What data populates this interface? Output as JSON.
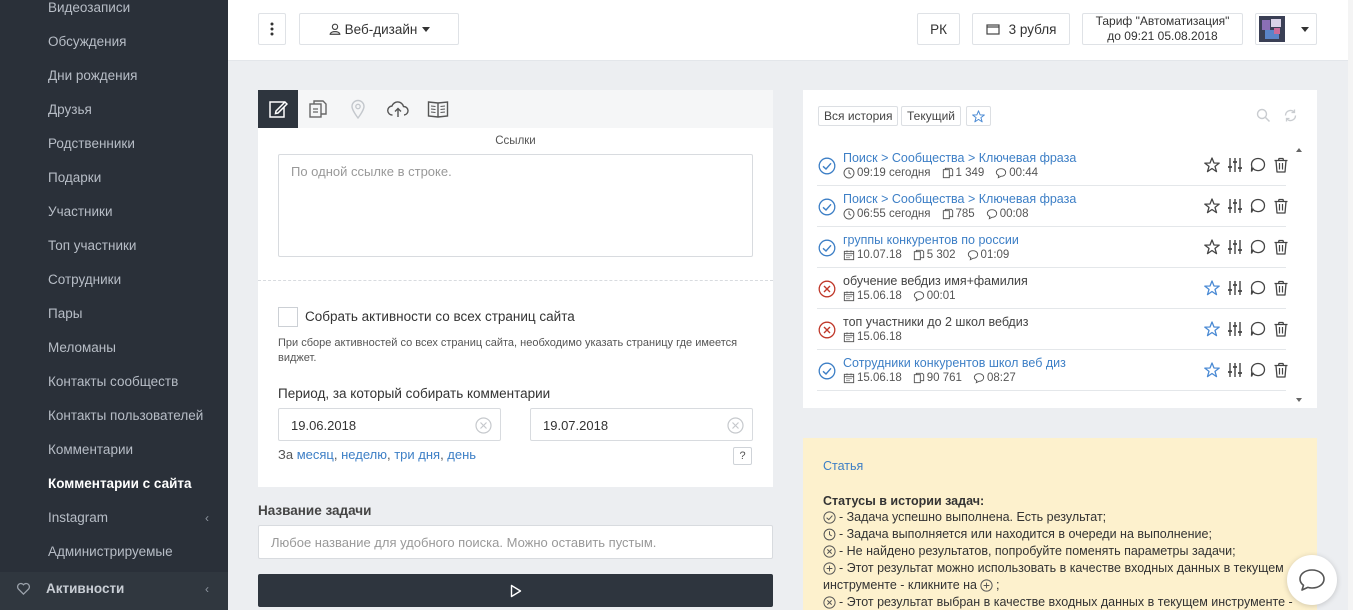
{
  "sidebar": {
    "items": [
      {
        "label": "Видеозаписи"
      },
      {
        "label": "Обсуждения"
      },
      {
        "label": "Дни рождения"
      },
      {
        "label": "Друзья"
      },
      {
        "label": "Родственники"
      },
      {
        "label": "Подарки"
      },
      {
        "label": "Участники"
      },
      {
        "label": "Топ участники"
      },
      {
        "label": "Сотрудники"
      },
      {
        "label": "Пары"
      },
      {
        "label": "Меломаны"
      },
      {
        "label": "Контакты сообществ"
      },
      {
        "label": "Контакты пользователей"
      },
      {
        "label": "Комментарии"
      },
      {
        "label": "Комментарии с сайта",
        "active": true
      },
      {
        "label": "Instagram",
        "expandable": true
      },
      {
        "label": "Администрируемые"
      }
    ],
    "bottom": {
      "label": "Активности",
      "icon": "heart-icon"
    }
  },
  "header": {
    "project": "Веб-дизайн",
    "lang": "РК",
    "balance": "3 рубля",
    "tariff_line1": "Тариф \"Автоматизация\"",
    "tariff_line2": "до 09:21 05.08.2018"
  },
  "form": {
    "links_label": "Ссылки",
    "links_placeholder": "По одной ссылке в строке.",
    "collect_label": "Собрать активности со всех страниц сайта",
    "collect_hint": "При сборе активностей со всех страниц сайта, необходимо указать страницу где имеется виджет.",
    "period_label": "Период, за который собирать комментарии",
    "date_from": "19.06.2018",
    "date_to": "19.07.2018",
    "quick_prefix": "За",
    "quick_month": "месяц",
    "quick_week": "неделю",
    "quick_3days": "три дня",
    "quick_day": "день",
    "help": "?",
    "task_label": "Название задачи",
    "task_placeholder": "Любое название для удобного поиска. Можно оставить пустым."
  },
  "history": {
    "tab_all": "Вся история",
    "tab_current": "Текущий",
    "rows": [
      {
        "status": "done",
        "title": "Поиск > Сообщества > Ключевая фраза",
        "date": "09:19 сегодня",
        "date_icon": "clock",
        "count": "1 349",
        "duration": "00:44",
        "starred": false
      },
      {
        "status": "done",
        "title": "Поиск > Сообщества > Ключевая фраза",
        "date": "06:55 сегодня",
        "date_icon": "clock",
        "count": "785",
        "duration": "00:08",
        "starred": false
      },
      {
        "status": "done",
        "title": "группы конкурентов по россии",
        "date": "10.07.18",
        "date_icon": "calendar",
        "count": "5 302",
        "duration": "01:09",
        "starred": false
      },
      {
        "status": "fail",
        "title": "обучение вебдиз имя+фамилия",
        "date": "15.06.18",
        "date_icon": "calendar",
        "count": "",
        "duration": "00:01",
        "starred": true
      },
      {
        "status": "fail",
        "title": "топ участники до 2 школ вебдиз",
        "date": "15.06.18",
        "date_icon": "calendar",
        "count": "",
        "duration": "",
        "starred": true
      },
      {
        "status": "done",
        "title": "Сотрудники конкурентов школ веб диз",
        "date": "15.06.18",
        "date_icon": "calendar",
        "count": "90 761",
        "duration": "08:27",
        "starred": true
      }
    ]
  },
  "article": {
    "link": "Статья",
    "statuses_title": "Статусы в истории задач:",
    "lines": [
      {
        "icon": "check-circle",
        "text": " - Задача успешно выполнена. Есть результат;"
      },
      {
        "icon": "clock",
        "text": " - Задача выполняется или находится в очереди на выполнение;"
      },
      {
        "icon": "x-circle",
        "text": " - Не найдено результатов, попробуйте поменять параметры задачи;"
      },
      {
        "icon": "plus-circle",
        "text": " - Этот результат можно использовать в качестве входных данных в текущем"
      },
      {
        "icon": "",
        "text": "инструменте - кликните на"
      },
      {
        "icon": "x-circle",
        "text": " - Этот результат выбран в качестве входных данных в текущем инструменте -"
      }
    ]
  },
  "colors": {
    "sidebar_bg": "#2a3039",
    "accent": "#3d7fc6",
    "done": "#3d7fc6",
    "fail": "#c0392b",
    "article_bg": "#fdf1cd"
  }
}
